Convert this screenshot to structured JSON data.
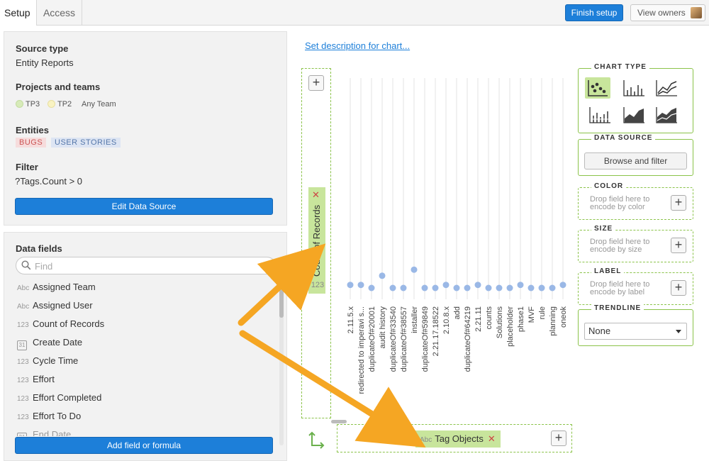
{
  "tabs": [
    {
      "label": "Setup"
    },
    {
      "label": "Access"
    }
  ],
  "header": {
    "finish_label": "Finish setup",
    "owners_label": "View owners"
  },
  "source": {
    "type_title": "Source type",
    "type_value": "Entity Reports",
    "projects_title": "Projects and teams",
    "teams": [
      {
        "label": "TP3",
        "color": "#d7ebb9"
      },
      {
        "label": "TP2",
        "color": "#f9f3c2"
      },
      {
        "label": "Any Team"
      }
    ],
    "entities_title": "Entities",
    "entities": [
      "BUGS",
      "USER STORIES"
    ],
    "filter_title": "Filter",
    "filter_value": "?Tags.Count > 0",
    "edit_button": "Edit Data Source"
  },
  "fields": {
    "title": "Data fields",
    "search_placeholder": "Find",
    "items": [
      {
        "type": "Abc",
        "name": "Assigned Team"
      },
      {
        "type": "Abc",
        "name": "Assigned User"
      },
      {
        "type": "123",
        "name": "Count of Records"
      },
      {
        "type": "31",
        "name": "Create Date"
      },
      {
        "type": "123",
        "name": "Cycle Time"
      },
      {
        "type": "123",
        "name": "Effort"
      },
      {
        "type": "123",
        "name": "Effort Completed"
      },
      {
        "type": "123",
        "name": "Effort To Do"
      },
      {
        "type": "31",
        "name": "End Date"
      }
    ],
    "add_button": "Add field or formula"
  },
  "chart": {
    "description_link": "Set description for chart...",
    "y_field": {
      "type": "123",
      "name": "Count of Records"
    },
    "x_field": {
      "type": "Abc",
      "name": "Tag Objects"
    }
  },
  "chart_data": {
    "type": "scatter",
    "categories": [
      "2.11.5.x",
      "redirected to imperavi s...",
      "duplicateOf#20001",
      "audit history",
      "duplicateOf#33540",
      "duplicateOf#38557",
      "installer",
      "duplicateOf#59849",
      "2.21.17.18522",
      "2.10.8.x",
      "add",
      "duplicateOf#64219",
      "2.21.11",
      "counts",
      "Solutions",
      "placeholder",
      "phase1",
      "MVF",
      "rule",
      "planning",
      "oneok"
    ],
    "values": [
      2,
      2,
      1,
      5,
      1,
      1,
      7,
      1,
      1,
      2,
      1,
      1,
      2,
      1,
      1,
      1,
      2,
      1,
      1,
      1,
      2
    ],
    "grid": true,
    "point_color": "#9ab8e6"
  },
  "right_panel": {
    "chart_type_title": "CHART TYPE",
    "chart_types": [
      "scatter-icon",
      "bar-icon",
      "line-icon",
      "stacked-bar-icon",
      "area-icon",
      "stacked-area-icon"
    ],
    "data_source_title": "DATA SOURCE",
    "browse_button": "Browse and filter",
    "color_title": "COLOR",
    "color_hint": "Drop field here to encode by color",
    "size_title": "SIZE",
    "size_hint": "Drop field here to encode by size",
    "label_title": "LABEL",
    "label_hint": "Drop field here to encode by label",
    "trendline_title": "TRENDLINE",
    "trendline_value": "None"
  },
  "colors": {
    "accent": "#1d7fd9",
    "drop_green": "#c8e59c",
    "arrow": "#f5a623"
  }
}
